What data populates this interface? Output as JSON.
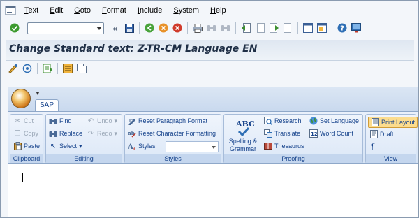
{
  "menu": {
    "items": [
      {
        "label": "Text",
        "accel": "T"
      },
      {
        "label": "Edit",
        "accel": "E"
      },
      {
        "label": "Goto",
        "accel": "G"
      },
      {
        "label": "Format",
        "accel": "F"
      },
      {
        "label": "Include",
        "accel": "I"
      },
      {
        "label": "System",
        "accel": "S"
      },
      {
        "label": "Help",
        "accel": "H"
      }
    ]
  },
  "toolbar": {
    "command_value": "",
    "history_back": "«"
  },
  "title": "Change Standard text: Z-TR-CM Language EN",
  "ribbon": {
    "tab": "SAP",
    "groups": {
      "clipboard": {
        "label": "Clipboard",
        "cut": "Cut",
        "copy": "Copy",
        "paste": "Paste"
      },
      "editing": {
        "label": "Editing",
        "find": "Find",
        "undo": "Undo",
        "replace": "Replace",
        "redo": "Redo",
        "select": "Select"
      },
      "styles": {
        "label": "Styles",
        "reset_paragraph": "Reset Paragraph Format",
        "reset_character": "Reset Character Formatting",
        "styles": "Styles",
        "styles_value": ""
      },
      "proofing": {
        "label": "Proofing",
        "abc": "ABC",
        "spelling_line1": "Spelling &",
        "spelling_line2": "Grammar",
        "research": "Research",
        "set_language": "Set Language",
        "translate": "Translate",
        "word_count": "Word Count",
        "thesaurus": "Thesaurus"
      },
      "view": {
        "label": "View",
        "print_layout": "Print Layout",
        "draft": "Draft",
        "pilcrow": "¶"
      }
    }
  },
  "colors": {
    "title_text": "#1f2f46",
    "ribbon_text": "#15428b",
    "active_view": "#fcdc8e"
  }
}
